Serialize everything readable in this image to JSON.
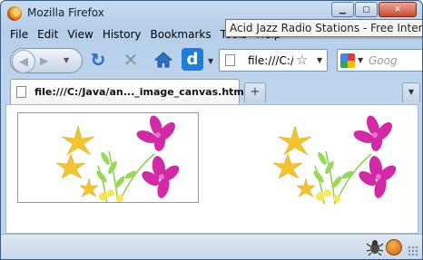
{
  "window": {
    "title": "Mozilla Firefox"
  },
  "menubar": {
    "items": [
      "File",
      "Edit",
      "View",
      "History",
      "Bookmarks",
      "Tools",
      "Help"
    ]
  },
  "tooltip": {
    "text": "Acid Jazz Radio Stations - Free Internet Radio"
  },
  "navbar": {
    "url": "file:///C:/",
    "search_placeholder": "Goog"
  },
  "tab": {
    "label": "file:///C:/Java/an..._image_canvas.html"
  },
  "newtab": {
    "label": "+"
  },
  "colors": {
    "accent": "#2c6ac2",
    "flower_pink": "#d02aa6",
    "flower_yellow": "#f4c430",
    "leaf_green": "#8ccf4a"
  },
  "icons": [
    "firefox-logo",
    "back-arrow",
    "forward-arrow",
    "reload",
    "stop",
    "home",
    "dictionary-d",
    "page",
    "bookmark-star",
    "google-g",
    "firebug",
    "cookie",
    "resize-grip"
  ]
}
